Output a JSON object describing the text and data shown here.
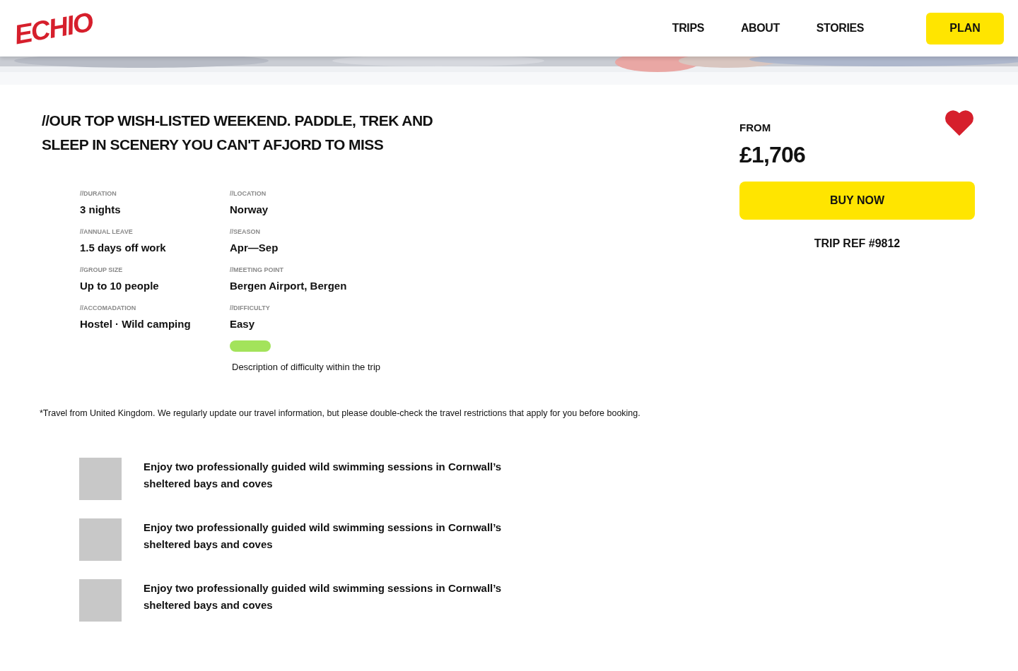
{
  "header": {
    "logo": "ECHIO",
    "nav": [
      "TRIPS",
      "ABOUT",
      "STORIES"
    ],
    "cta": "PLAN"
  },
  "tagline": "//OUR TOP WISH-LISTED WEEKEND. PADDLE, TREK AND SLEEP IN SCENERY YOU CAN'T AFJORD TO MISS",
  "details": [
    {
      "label": "//DURATION",
      "value": "3 nights"
    },
    {
      "label": "//LOCATION",
      "value": "Norway"
    },
    {
      "label": "//ANNUAL LEAVE",
      "value": "1.5 days off work"
    },
    {
      "label": "//SEASON",
      "value": "Apr—Sep"
    },
    {
      "label": "//GROUP SIZE",
      "value": "Up to 10 people"
    },
    {
      "label": "//MEETING POINT",
      "value": "Bergen Airport, Bergen"
    },
    {
      "label": "//ACCOMADATION",
      "value": "Hostel · Wild camping"
    },
    {
      "label": "//DIFFICULTY",
      "value": "Easy",
      "color": "#a3e35b",
      "description": "Description of difficulty within the trip"
    }
  ],
  "booking": {
    "from_label": "FROM",
    "price": "£1,706",
    "favorited": true,
    "buy": "BUY NOW",
    "trip_ref": "TRIP REF #9812"
  },
  "disclaimer": "*Travel from United Kingdom. We regularly update our travel information, but please double-check the travel restrictions that apply for you before booking.",
  "highlights": [
    {
      "text": "Enjoy two professionally guided wild swimming sessions in Cornwall’s sheltered bays and coves"
    },
    {
      "text": "Enjoy two professionally guided wild swimming sessions in Cornwall’s sheltered bays and coves"
    },
    {
      "text": "Enjoy two professionally guided wild swimming sessions in Cornwall’s sheltered bays and coves"
    }
  ]
}
